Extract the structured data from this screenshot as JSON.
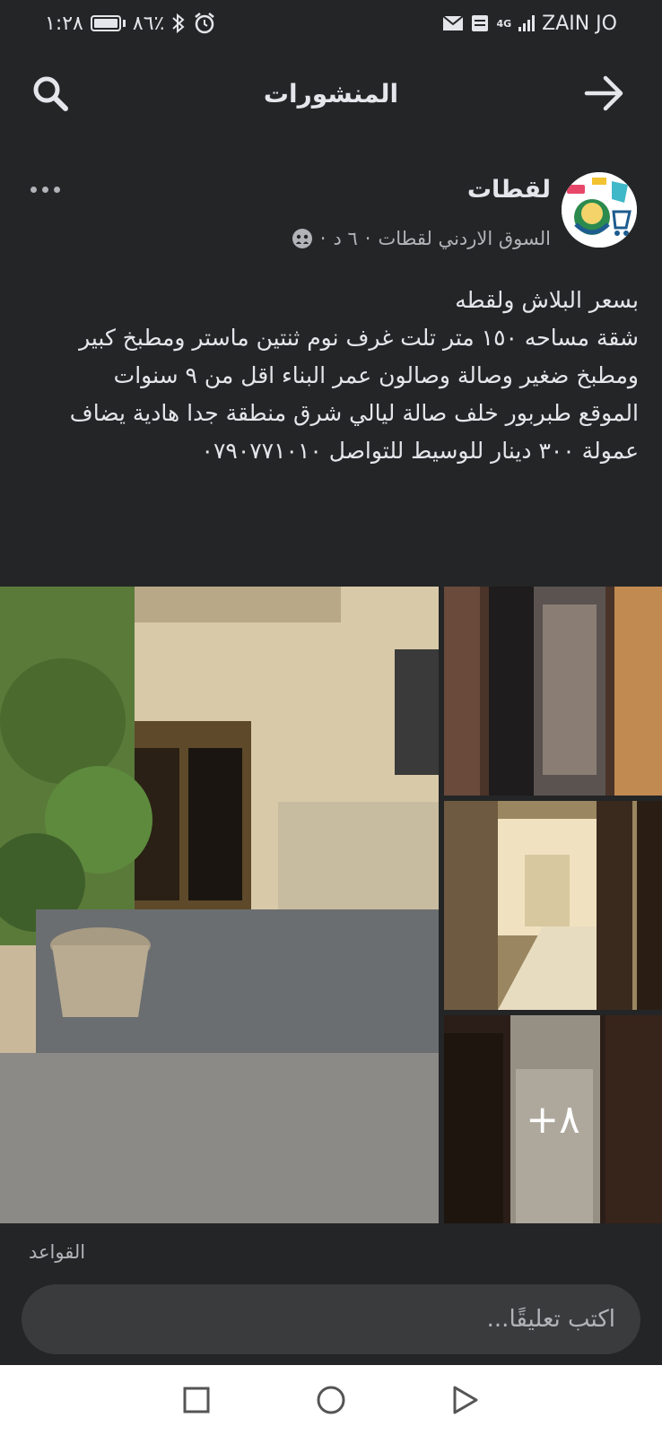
{
  "status_bar": {
    "time": "١:٢٨",
    "battery": "٨٦٪",
    "carrier": "ZAIN JO",
    "network": "4G"
  },
  "header": {
    "title": "المنشورات",
    "search_icon": "search-icon",
    "back_icon": "arrow-right-icon"
  },
  "post": {
    "page_name": "لقطات",
    "group_name": "السوق الاردني لقطات",
    "time": "٦ د",
    "privacy_icon": "group-icon",
    "lines": [
      "بسعر البلاش ولقطه",
      "شقة مساحه ١٥٠ متر تلت غرف نوم ثنتين ماستر ومطبخ كبير ومطبخ ضغير وصالة وصالون عمر البناء اقل من ٩ سنوات",
      "الموقع طبربور خلف صالة ليالي شرق منطقة جدا هادية يضاف عمولة ٣٠٠ دينار للوسيط للتواصل ٠٧٩٠٧٧١٠١٠"
    ],
    "more_photos": "+٨"
  },
  "rules_label": "القواعد",
  "comment": {
    "placeholder": "اكتب تعليقًا..."
  },
  "nav": {
    "recents_icon": "square-icon",
    "home_icon": "circle-icon",
    "back_icon": "triangle-back-icon"
  },
  "colors": {
    "background": "#242526",
    "text": "#e4e6eb",
    "secondary": "#b0b3b8",
    "input_bg": "#3a3b3c"
  }
}
